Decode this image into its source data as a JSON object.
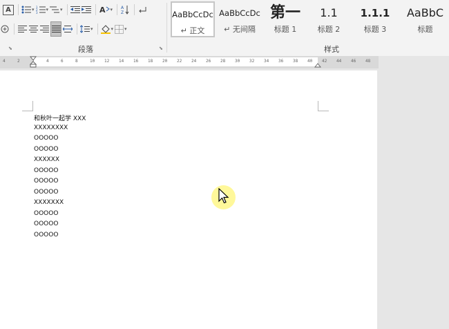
{
  "paragraph_group": {
    "label": "段落"
  },
  "styles_group": {
    "label": "样式",
    "items": [
      {
        "preview": "AaBbCcDc",
        "name": "↵ 正文"
      },
      {
        "preview": "AaBbCcDc",
        "name": "↵ 无间隔"
      },
      {
        "preview": "第一",
        "name": "标题 1"
      },
      {
        "preview": "1.1",
        "name": "标题 2"
      },
      {
        "preview": "1.1.1",
        "name": "标题 3"
      },
      {
        "preview": "AaBbC",
        "name": "标题"
      }
    ]
  },
  "ruler": {
    "ticks": [
      "4",
      "2",
      "2",
      "4",
      "6",
      "8",
      "10",
      "12",
      "14",
      "16",
      "18",
      "20",
      "22",
      "24",
      "26",
      "28",
      "30",
      "32",
      "34",
      "36",
      "38",
      "40",
      "42",
      "44",
      "46",
      "48"
    ]
  },
  "document": {
    "lines": [
      "和秋叶一起学 XXX",
      "XXXXXXXX",
      "OOOOO",
      "OOOOO",
      "XXXXXX",
      "OOOOO",
      "OOOOO",
      "OOOOO",
      "XXXXXXX",
      "OOOOO",
      "OOOOO",
      "OOOOO"
    ]
  },
  "colors": {
    "cursor_halo": "#fff578",
    "ribbon_bg": "#f3f3f3",
    "page_bg": "#ffffff"
  }
}
